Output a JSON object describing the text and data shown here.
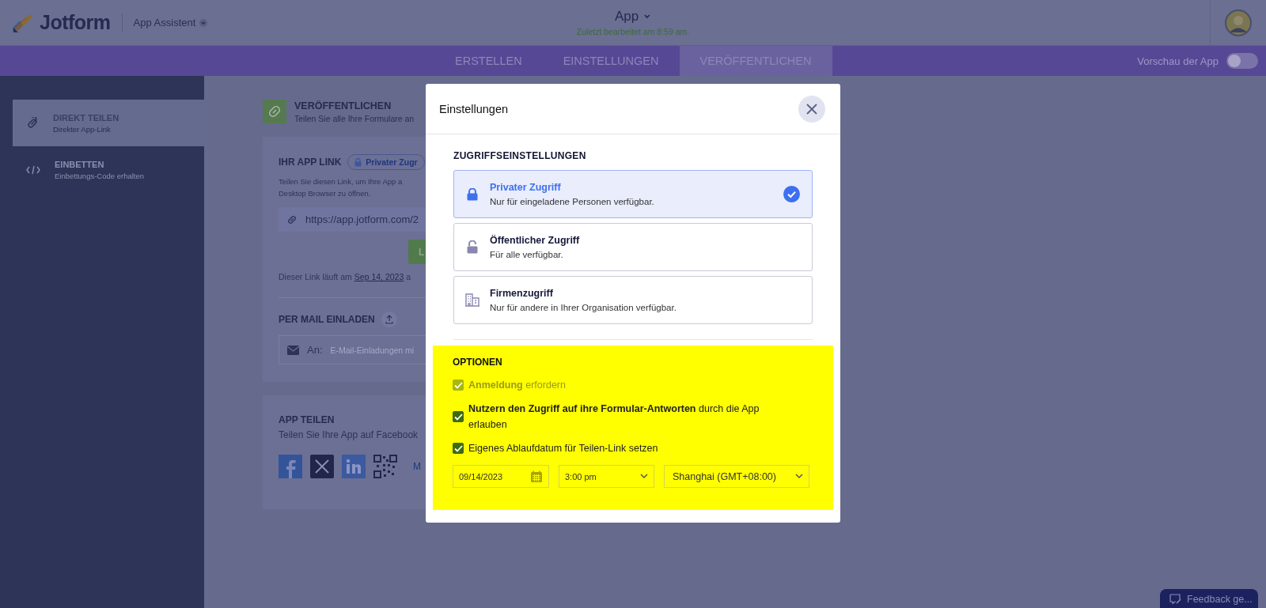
{
  "header": {
    "logo": "Jotform",
    "app_switcher": "App Assistent",
    "app_title": "App",
    "last_edited": "Zuletzt bearbeitet am 8:59 am."
  },
  "nav_tabs": [
    {
      "label": "ERSTELLEN",
      "selected": false
    },
    {
      "label": "EINSTELLUNGEN",
      "selected": false
    },
    {
      "label": "VERÖFFENTLICHEN",
      "selected": true
    }
  ],
  "preview_toggle": {
    "label": "Vorschau der App",
    "on": false
  },
  "sidebar": {
    "items": [
      {
        "kind": "link",
        "title": "DIREKT TEILEN",
        "subtitle": "Direkter App-Link",
        "selected": true
      },
      {
        "kind": "code",
        "title": "EINBETTEN",
        "subtitle": "Einbettungs-Code erhalten",
        "selected": false
      }
    ]
  },
  "page": {
    "title": "VERÖFFENTLICHEN",
    "subtitle": "Teilen Sie alle Ihre Formulare an",
    "app_link": {
      "heading": "IHR APP LINK",
      "badge": "Privater Zugr",
      "description_lines": [
        "Teilen Sie diesen Link, um Ihre App a",
        "Desktop Browser zu öffnen."
      ],
      "url": "https://app.jotform.com/2",
      "button": "L",
      "expiry_prefix": "Dieser Link läuft am",
      "expiry_date": "Sep 14, 2023",
      "expiry_suffix": "a"
    },
    "invite": {
      "heading": "PER MAIL EINLADEN",
      "to_label": "An:",
      "placeholder": "E-Mail-Einladungen mi"
    },
    "share": {
      "heading": "APP TEILEN",
      "subtitle": "Teilen Sie Ihre App auf Facebook",
      "networks": [
        {
          "kind": "facebook"
        },
        {
          "kind": "x"
        },
        {
          "kind": "linkedin"
        },
        {
          "kind": "qr"
        }
      ],
      "more": "M"
    }
  },
  "modal": {
    "title": "Einstellungen",
    "access_heading": "ZUGRIFFSEINSTELLUNGEN",
    "access_options": [
      {
        "kind": "lock",
        "title": "Privater Zugriff",
        "description": "Nur für eingeladene Personen verfügbar.",
        "selected": true
      },
      {
        "kind": "unlock",
        "title": "Öffentlicher Zugriff",
        "description": "Für alle verfügbar.",
        "selected": false
      },
      {
        "kind": "building",
        "title": "Firmenzugriff",
        "description": "Nur für andere in Ihrer Organisation verfügbar.",
        "selected": false
      }
    ],
    "options_heading": "OPTIONEN",
    "options": [
      {
        "label": "**Anmeldung** erfordern",
        "checked": true,
        "disabled": true
      },
      {
        "label": "**Nutzern den Zugriff auf ihre Formular-Antworten** durch die App erlauben",
        "checked": true,
        "disabled": false
      },
      {
        "label": "Eigenes Ablaufdatum für Teilen-Link setzen",
        "checked": true,
        "disabled": false
      }
    ],
    "date": "09/14/2023",
    "time": "3:00 pm",
    "timezone": "Shanghai (GMT+08:00)"
  },
  "feedback": "Feedback ge..."
}
